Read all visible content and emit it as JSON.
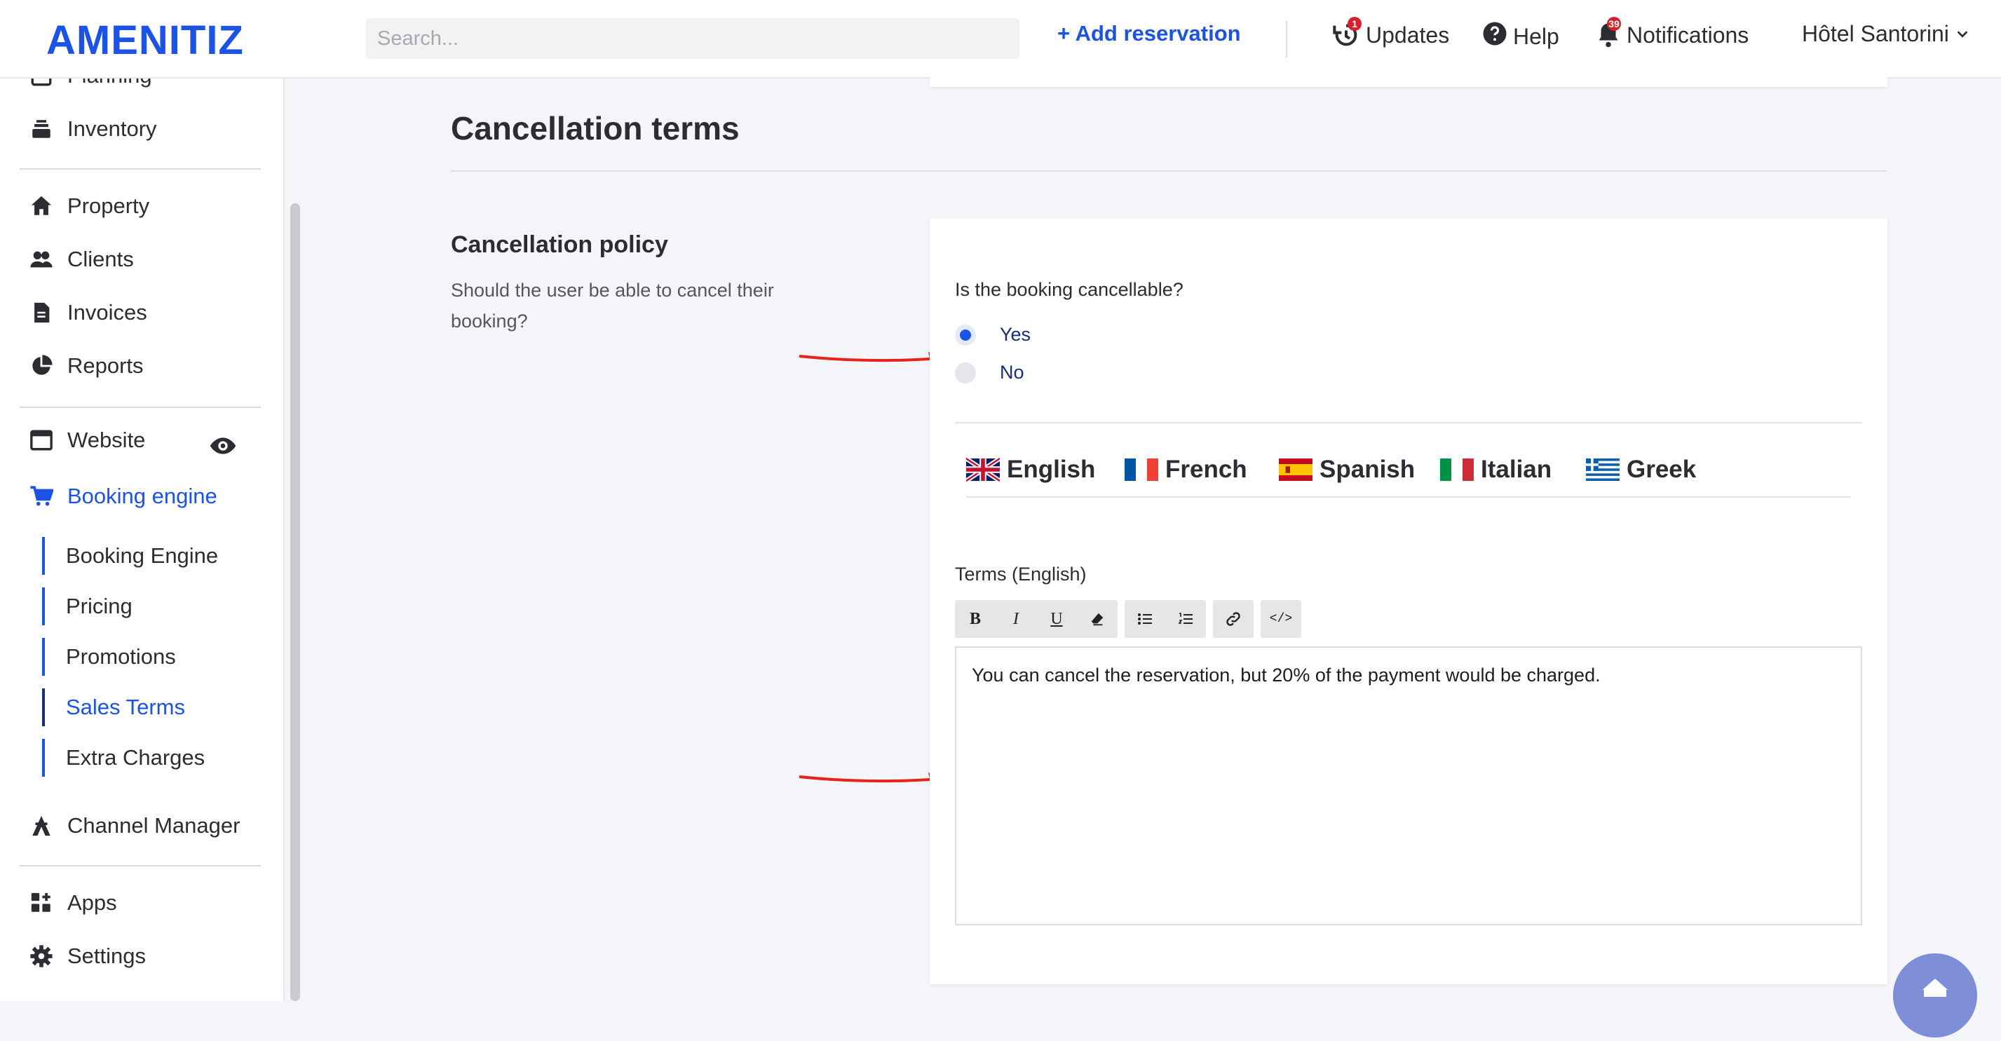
{
  "header": {
    "logo": "AMENITIZ",
    "search_placeholder": "Search...",
    "add_reservation": "Add reservation",
    "updates": {
      "label": "Updates",
      "count": "1"
    },
    "help": "Help",
    "notifications": {
      "label": "Notifications",
      "count": "39"
    },
    "hotel": "Hôtel Santorini"
  },
  "sidebar": {
    "items_top": [
      {
        "label": "Planning"
      },
      {
        "label": "Inventory"
      }
    ],
    "items_mid": [
      {
        "label": "Property"
      },
      {
        "label": "Clients"
      },
      {
        "label": "Invoices"
      },
      {
        "label": "Reports"
      }
    ],
    "website": "Website",
    "booking_engine": "Booking engine",
    "sub_items": [
      {
        "label": "Booking Engine"
      },
      {
        "label": "Pricing"
      },
      {
        "label": "Promotions"
      },
      {
        "label": "Sales Terms"
      },
      {
        "label": "Extra Charges"
      }
    ],
    "channel_manager": "Channel Manager",
    "apps": "Apps",
    "settings": "Settings"
  },
  "main": {
    "section_title": "Cancellation terms",
    "policy_title": "Cancellation policy",
    "policy_desc": "Should the user be able to cancel their booking?",
    "question": "Is the booking cancellable?",
    "options": [
      {
        "label": "Yes",
        "checked": true
      },
      {
        "label": "No",
        "checked": false
      }
    ],
    "languages": [
      {
        "label": "English"
      },
      {
        "label": "French"
      },
      {
        "label": "Spanish"
      },
      {
        "label": "Italian"
      },
      {
        "label": "Greek"
      }
    ],
    "terms_label": "Terms (English)",
    "terms_text": "You can cancel the reservation, but 20% of the payment would be charged."
  }
}
